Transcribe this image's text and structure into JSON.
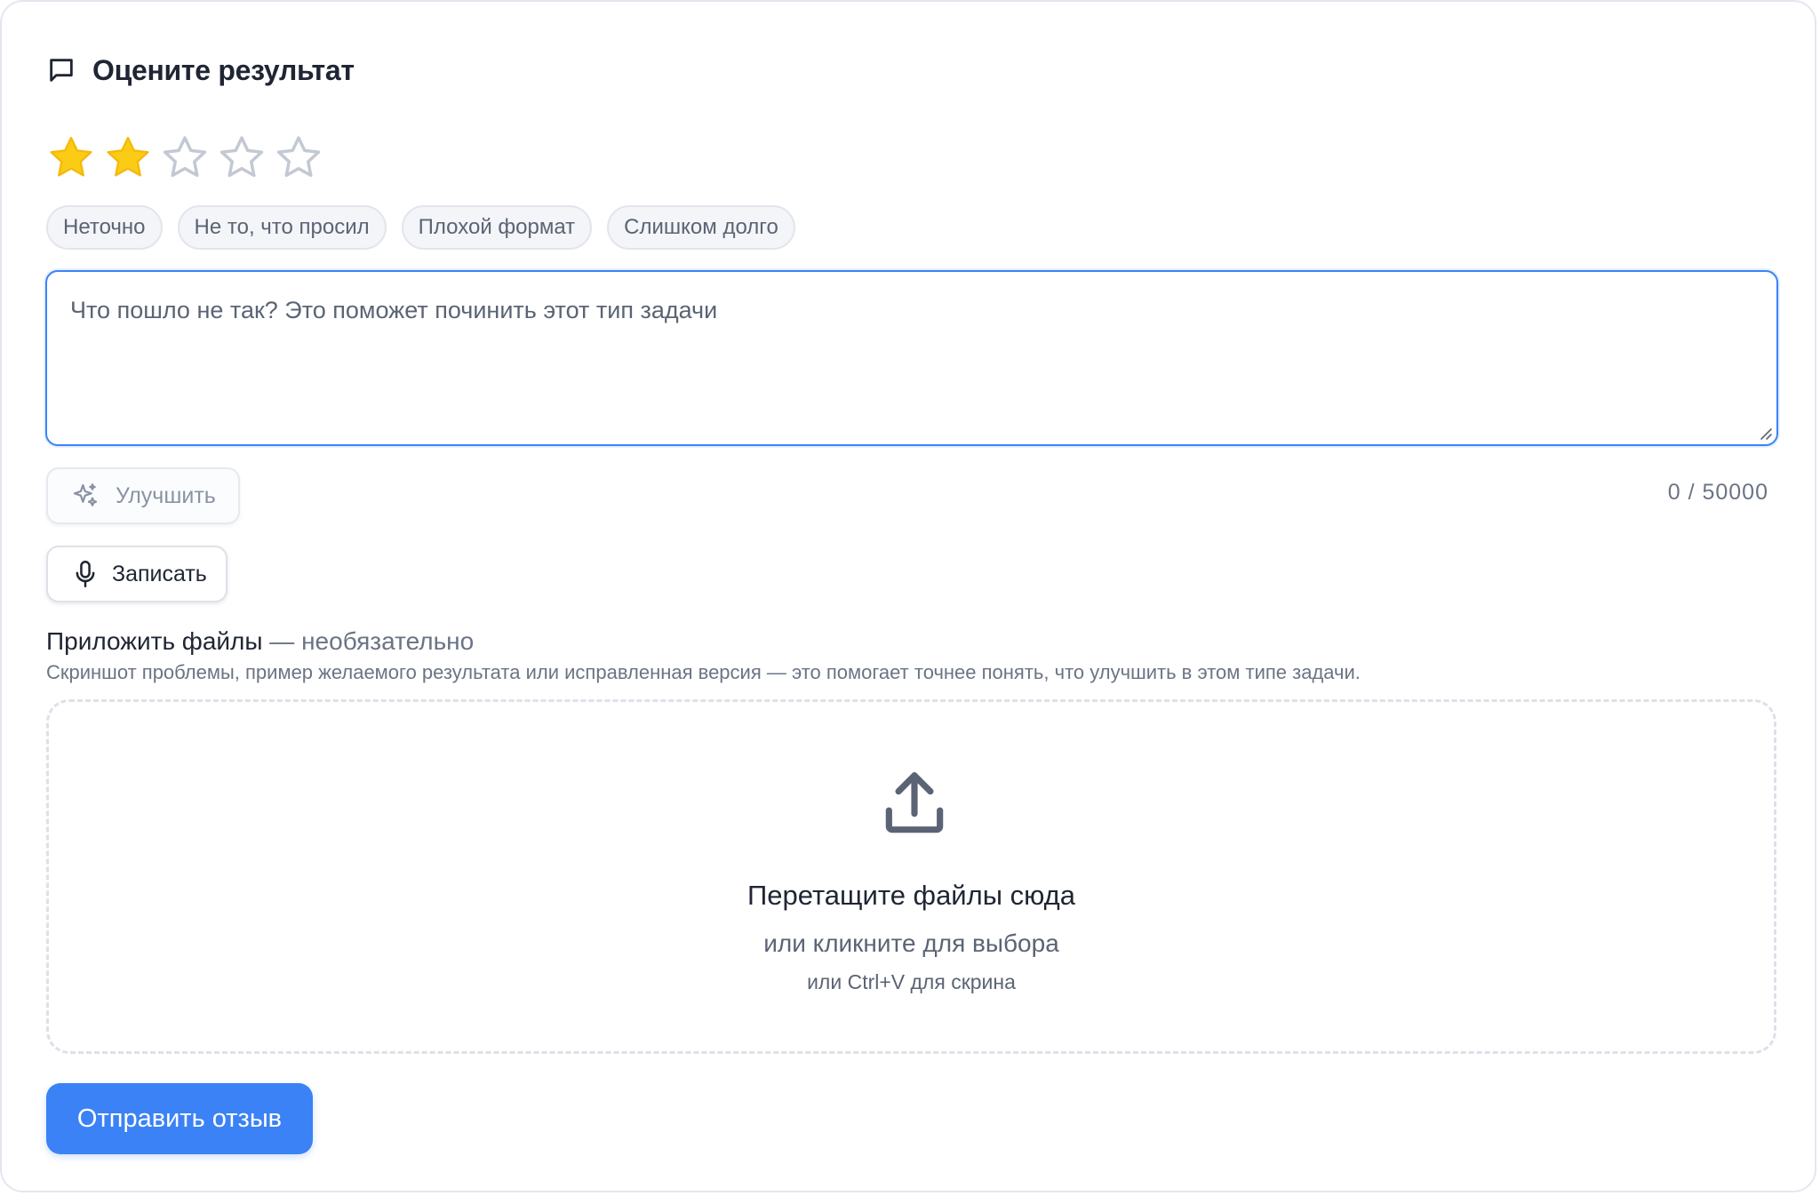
{
  "header": {
    "title": "Оцените результат",
    "icon": "message-square-icon"
  },
  "rating": {
    "value": 2,
    "max": 5,
    "filled_color": "#FACC15",
    "empty_color": "#C3C9D3"
  },
  "chips": [
    {
      "label": "Неточно"
    },
    {
      "label": "Не то, что просил"
    },
    {
      "label": "Плохой формат"
    },
    {
      "label": "Слишком долго"
    }
  ],
  "feedback": {
    "value": "",
    "placeholder": "Что пошло не так? Это поможет починить этот тип задачи"
  },
  "improve_button": {
    "label": "Улучшить",
    "icon": "sparkles-icon"
  },
  "counter": {
    "text": "0 / 50000"
  },
  "record_button": {
    "label": "Записать",
    "icon": "microphone-icon"
  },
  "attachments": {
    "title": "Приложить файлы",
    "optional": " — необязательно",
    "hint": "Скриншот проблемы, пример желаемого результата или исправленная версия — это помогает точнее понять, что улучшить в этом типе задачи.",
    "dropzone": {
      "icon": "upload-icon",
      "main": "Перетащите файлы сюда",
      "sub": "или кликните для выбора",
      "sub2": "или Ctrl+V для скрина"
    }
  },
  "submit_button": {
    "label": "Отправить отзыв"
  },
  "colors": {
    "accent": "#3B82F6",
    "text": "#1F2533",
    "muted": "#5B6474"
  }
}
